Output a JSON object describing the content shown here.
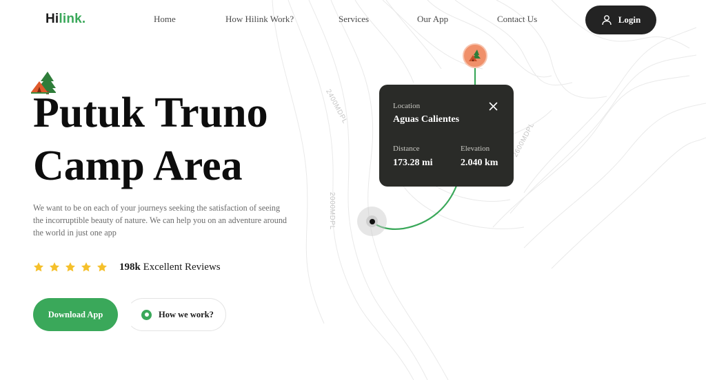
{
  "nav": {
    "logo_part1": "Hi",
    "logo_part2": "link.",
    "links": [
      "Home",
      "How Hilink Work?",
      "Services",
      "Our App",
      "Contact Us"
    ],
    "login_label": "Login"
  },
  "hero": {
    "title_line1": "Putuk Truno",
    "title_line2": "Camp Area",
    "description": "We want to be on each of your journeys seeking the satisfaction of seeing the incorruptible beauty of nature. We can help you on an adventure around the world in just one app",
    "rating_stars": 5,
    "reviews_count": "198k",
    "reviews_text": "Excellent Reviews",
    "download_label": "Download App",
    "how_label": "How we work?"
  },
  "map": {
    "location_label": "Location",
    "location_value": "Aguas Calientes",
    "distance_label": "Distance",
    "distance_value": "173.28 mi",
    "elevation_label": "Elevation",
    "elevation_value": "2.040 km",
    "contour_labels": [
      "2400MDPL",
      "2000MDPL",
      "2600MDPL"
    ]
  },
  "colors": {
    "accent": "#3aa85a",
    "dark": "#232323",
    "card": "#2a2b28",
    "pin": "#f0906a",
    "star": "#f5c02b"
  },
  "icons": [
    "user-icon",
    "camp-tent-icon",
    "star-icon",
    "play-icon",
    "close-icon",
    "map-pin-icon"
  ]
}
